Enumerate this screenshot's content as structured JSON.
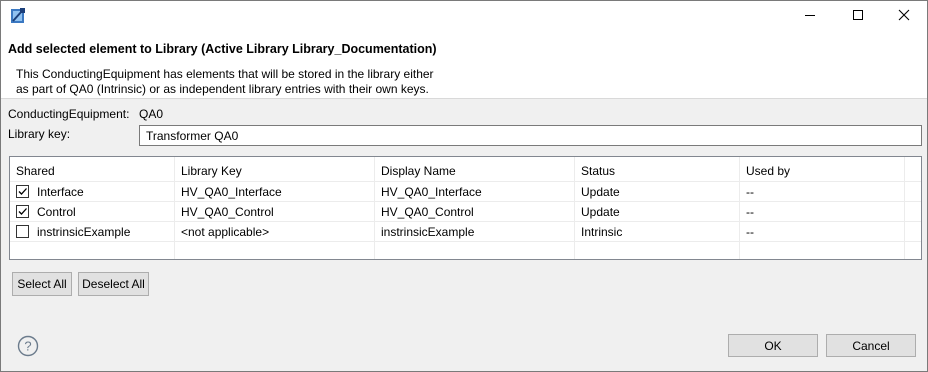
{
  "window": {
    "app_icon": "eclipse-app-icon",
    "minimize_icon": "minimize-icon",
    "maximize_icon": "maximize-icon",
    "close_icon": "close-icon"
  },
  "header": {
    "title": "Add selected element to Library (Active Library Library_Documentation)",
    "description_line1": "This ConductingEquipment has elements that will be stored in the library either",
    "description_line2": "as part of QA0 (Intrinsic) or as independent library entries with their own keys."
  },
  "form": {
    "equipment_label": "ConductingEquipment:",
    "equipment_value": "QA0",
    "library_key_label": "Library key:",
    "library_key_value": "Transformer QA0"
  },
  "table": {
    "columns": [
      "Shared",
      "Library Key",
      "Display Name",
      "Status",
      "Used by"
    ],
    "rows": [
      {
        "checked": true,
        "shared": "Interface",
        "library_key": "HV_QA0_Interface",
        "display_name": "HV_QA0_Interface",
        "status": "Update",
        "used_by": "--"
      },
      {
        "checked": true,
        "shared": "Control",
        "library_key": "HV_QA0_Control",
        "display_name": "HV_QA0_Control",
        "status": "Update",
        "used_by": "--"
      },
      {
        "checked": false,
        "shared": "instrinsicExample",
        "library_key": "<not applicable>",
        "display_name": "instrinsicExample",
        "status": "Intrinsic",
        "used_by": "--"
      }
    ]
  },
  "buttons": {
    "select_all": "Select All",
    "deselect_all": "Deselect All",
    "ok": "OK",
    "cancel": "Cancel"
  },
  "help_icon": "help-icon"
}
